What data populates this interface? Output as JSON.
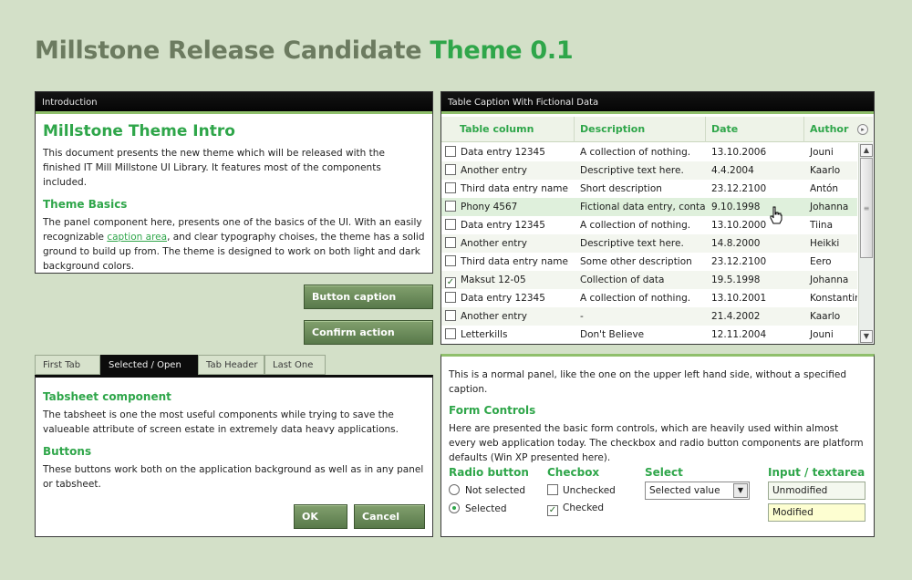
{
  "title": {
    "main": "Millstone Release Candidate",
    "accent": "Theme 0.1"
  },
  "intro_panel": {
    "caption": "Introduction",
    "heading": "Millstone Theme Intro",
    "para1": "This document presents the new theme which will be released with the finished IT Mill Millstone UI Library. It features most of the components included.",
    "subheading": "Theme Basics",
    "para2_before": "The panel component here, presents one of the basics of the UI. With an easily recognizable ",
    "para2_link": "caption area",
    "para2_after": ", and clear typography choises, the theme has a solid ground to build up from. The theme is designed to work on both light and dark background colors."
  },
  "buttons_app": {
    "button_caption": "Button caption",
    "confirm_action": "Confirm action"
  },
  "table": {
    "caption": "Table Caption With Fictional Data",
    "columns": [
      "Table column",
      "Description",
      "Date",
      "Author"
    ],
    "rows": [
      {
        "checked": false,
        "col1": "Data entry 12345",
        "col2": "A collection of nothing.",
        "date": "13.10.2006",
        "author": "Jouni"
      },
      {
        "checked": false,
        "col1": "Another entry",
        "col2": "Descriptive text here.",
        "date": "4.4.2004",
        "author": "Kaarlo"
      },
      {
        "checked": false,
        "col1": "Third data entry name",
        "col2": "Short description",
        "date": "23.12.2100",
        "author": "Antón"
      },
      {
        "checked": false,
        "col1": "Phony 4567",
        "col2": "Fictional data entry, containing",
        "date": "9.10.1998",
        "author": "Johanna"
      },
      {
        "checked": false,
        "col1": "Data entry 12345",
        "col2": "A collection of nothing.",
        "date": "13.10.2000",
        "author": "Tiina"
      },
      {
        "checked": false,
        "col1": "Another entry",
        "col2": "Descriptive text here.",
        "date": "14.8.2000",
        "author": "Heikki"
      },
      {
        "checked": false,
        "col1": "Third data entry name",
        "col2": "Some other description",
        "date": "23.12.2100",
        "author": "Eero"
      },
      {
        "checked": true,
        "col1": "Maksut 12-05",
        "col2": "Collection of data",
        "date": "19.5.1998",
        "author": "Johanna"
      },
      {
        "checked": false,
        "col1": "Data entry 12345",
        "col2": "A collection of nothing.",
        "date": "13.10.2001",
        "author": "Konstantin"
      },
      {
        "checked": false,
        "col1": "Another entry",
        "col2": "-",
        "date": "21.4.2002",
        "author": "Kaarlo"
      },
      {
        "checked": false,
        "col1": "Letterkills",
        "col2": "Don't Believe",
        "date": "12.11.2004",
        "author": "Jouni"
      }
    ],
    "hover_row_index": 3
  },
  "tabs": {
    "labels": [
      "First Tab",
      "Selected / Open",
      "Tab Header",
      "Last One"
    ],
    "active_index": 1,
    "heading1": "Tabsheet component",
    "para1": "The tabsheet is one the most useful components while trying to save the valueable attribute of screen estate in extremely data heavy applications.",
    "heading2": "Buttons",
    "para2": "These buttons work both on the application background as well as in any panel or tabsheet.",
    "ok": "OK",
    "cancel": "Cancel"
  },
  "form_panel": {
    "intro": "This is a normal panel, like the one on the upper left hand side, without a specified caption.",
    "heading": "Form Controls",
    "para": "Here are presented the basic form controls, which are heavily used within almost every web application today. The checkbox and radio button components are platform defaults (Win XP presented here).",
    "radio_label": "Radio button",
    "radio_opt1": "Not selected",
    "radio_opt2": "Selected",
    "checkbox_label": "Checbox",
    "checkbox_opt1": "Unchecked",
    "checkbox_opt2": "Checked",
    "select_label": "Select",
    "select_value": "Selected value",
    "input_label": "Input / textarea",
    "input1": "Unmodified",
    "input2": "Modified"
  },
  "colors": {
    "accent": "#2fa64a",
    "background": "#d3e0c8",
    "caption_bar": "#0c0c0c"
  }
}
